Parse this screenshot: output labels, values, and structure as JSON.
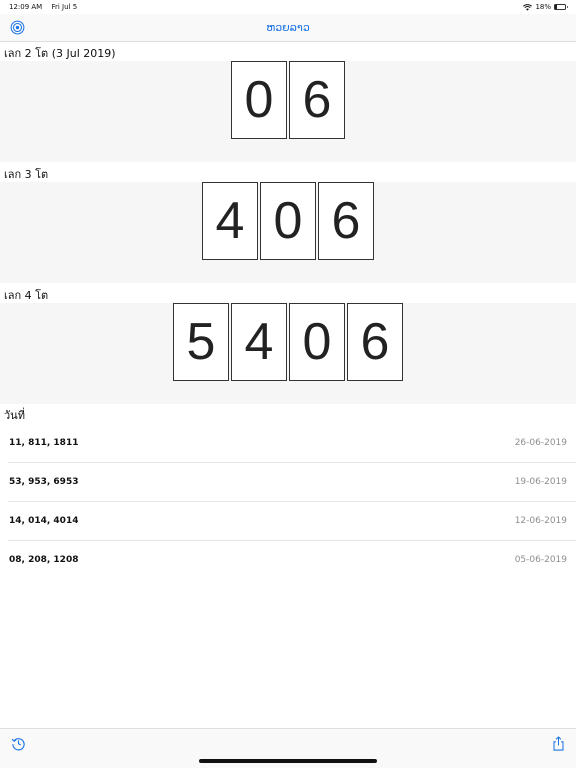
{
  "status": {
    "time": "12:09 AM",
    "date": "Fri Jul 5",
    "battery_text": "18%",
    "battery_level": 0.18
  },
  "nav": {
    "title": "ຫວຍລາວ",
    "left_icon": "settings-circle-icon"
  },
  "sections": [
    {
      "label": "เลก 2 โต (3 Jul 2019)",
      "digits": [
        "0",
        "6"
      ]
    },
    {
      "label": "เลก 3 โต",
      "digits": [
        "4",
        "0",
        "6"
      ]
    },
    {
      "label": "เลก 4 โต",
      "digits": [
        "5",
        "4",
        "0",
        "6"
      ]
    }
  ],
  "history": {
    "label": "วันที่",
    "items": [
      {
        "numbers": "11, 811, 1811",
        "date": "26-06-2019"
      },
      {
        "numbers": "53, 953, 6953",
        "date": "19-06-2019"
      },
      {
        "numbers": "14, 014, 4014",
        "date": "12-06-2019"
      },
      {
        "numbers": "08, 208, 1208",
        "date": "05-06-2019"
      }
    ]
  },
  "toolbar": {
    "left_icon": "history-icon",
    "right_icon": "share-icon"
  },
  "colors": {
    "accent": "#1a73e8",
    "panel": "#f6f6f6",
    "date_gray": "#8e8e8e"
  }
}
